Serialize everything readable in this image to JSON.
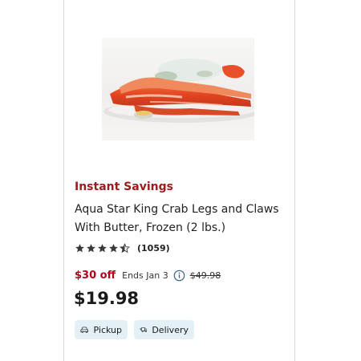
{
  "product": {
    "image_alt": "King crab legs and claws on a plate",
    "savings_label": "Instant Savings",
    "title": "Aqua Star King Crab Legs and Claws With Butter, Frozen (2 lbs.)",
    "rating": 4.5,
    "review_count": "(1059)",
    "discount": "$30 off",
    "ends": "Ends Jan 3",
    "was_price": "$49.98",
    "price": "$19.98"
  },
  "fulfillment": {
    "pickup_label": "Pickup",
    "delivery_label": "Delivery"
  },
  "colors": {
    "savings": "#9b1c1c",
    "discount": "#b3001b",
    "chip_background": "#e3f1f7",
    "star": "#3a3a3a"
  },
  "icons": {
    "info": "info-circle-icon",
    "pickup": "car-icon",
    "delivery": "delivery-truck-icon"
  }
}
